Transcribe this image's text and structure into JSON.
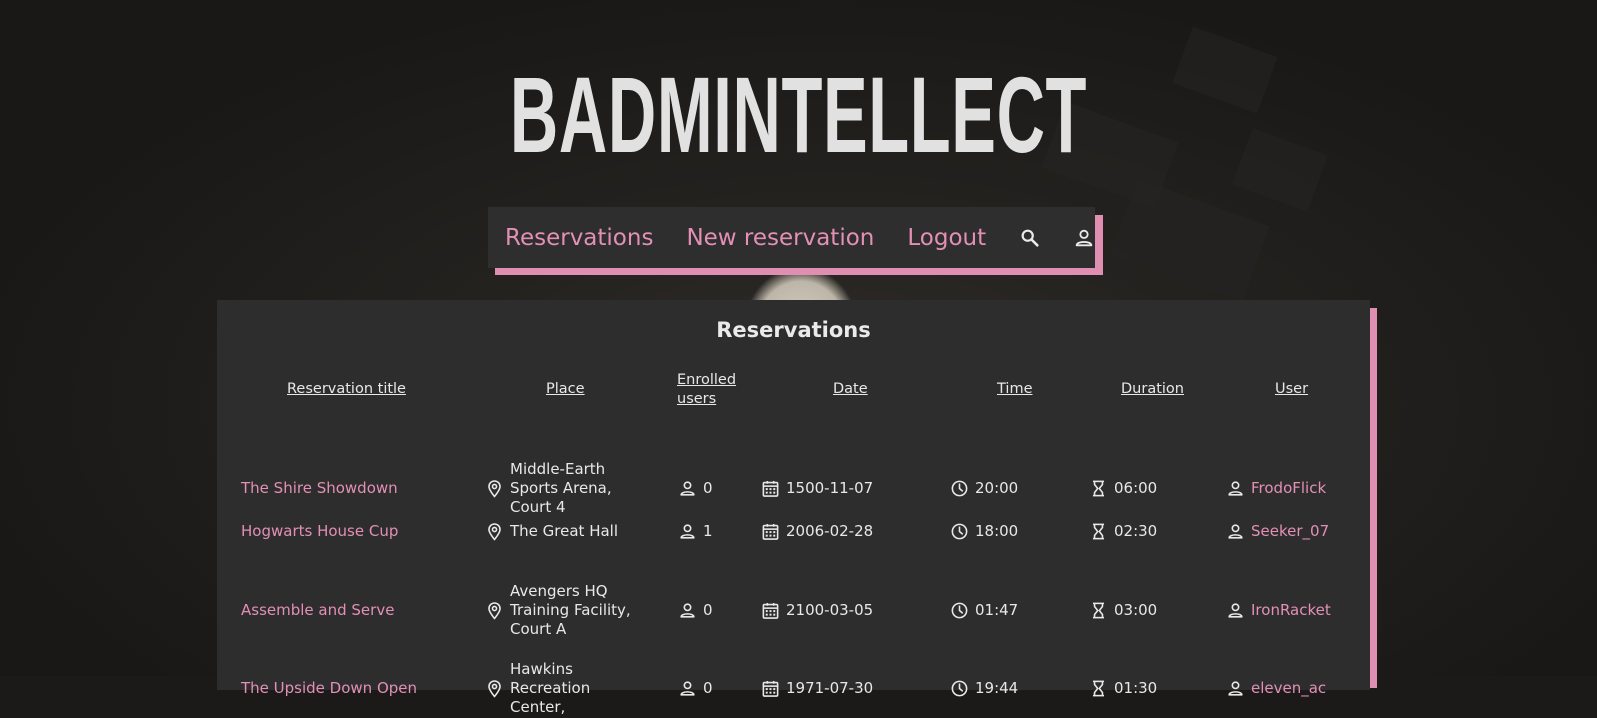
{
  "app": {
    "logo": "BADMINTELLECT"
  },
  "nav": {
    "reservations": "Reservations",
    "new_reservation": "New reservation",
    "logout": "Logout",
    "search_icon": "search-icon",
    "profile_icon": "user-icon"
  },
  "panel": {
    "title": "Reservations",
    "headers": {
      "title": "Reservation title",
      "place": "Place",
      "enrolled_1": "Enrolled",
      "enrolled_2": "users",
      "date": "Date",
      "time": "Time",
      "duration": "Duration",
      "user": "User"
    },
    "rows": [
      {
        "title": "The Shire Showdown",
        "place": [
          "Middle-Earth",
          "Sports Arena,",
          "Court 4"
        ],
        "enrolled": "0",
        "date": "1500-11-07",
        "time": "20:00",
        "duration": "06:00",
        "user": [
          "FrodoFlick"
        ]
      },
      {
        "title": "Hogwarts House Cup",
        "place": [
          "The Great Hall"
        ],
        "enrolled": "1",
        "date": "2006-02-28",
        "time": "18:00",
        "duration": "02:30",
        "user": [
          "Seeker_07"
        ]
      },
      {
        "title": "Assemble and Serve",
        "place": [
          "Avengers HQ",
          "Training Facility,",
          "Court A"
        ],
        "enrolled": "0",
        "date": "2100-03-05",
        "time": "01:47",
        "duration": "03:00",
        "user": [
          "IronRacket"
        ]
      },
      {
        "title": "The Upside Down Open",
        "place": [
          "Hawkins",
          "Recreation Center,"
        ],
        "enrolled": "0",
        "date": "1971-07-30",
        "time": "19:44",
        "duration": "01:30",
        "user": [
          "eleven_ac"
        ]
      }
    ]
  },
  "colors": {
    "accent": "#e38fb6",
    "panel": "#2d2d2d",
    "text": "#e8e8e8"
  }
}
